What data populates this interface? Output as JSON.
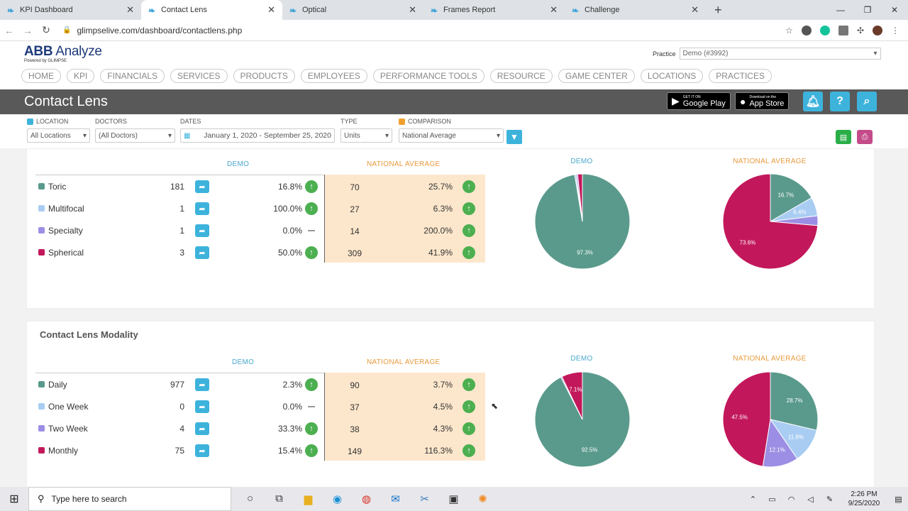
{
  "browser": {
    "tabs": [
      {
        "label": "KPI Dashboard",
        "active": false
      },
      {
        "label": "Contact Lens",
        "active": true
      },
      {
        "label": "Optical",
        "active": false
      },
      {
        "label": "Frames Report",
        "active": false
      },
      {
        "label": "Challenge",
        "active": false
      }
    ],
    "url": "glimpselive.com/dashboard/contactlens.php"
  },
  "header": {
    "logo_main_1": "ABB",
    "logo_main_2": " Analyze",
    "logo_sub": "Powered by GLIMPSE",
    "practice_label": "Practice",
    "practice_value": "Demo (#3992)",
    "menu": [
      "HOME",
      "KPI",
      "FINANCIALS",
      "SERVICES",
      "PRODUCTS",
      "EMPLOYEES",
      "PERFORMANCE TOOLS",
      "RESOURCE",
      "GAME CENTER",
      "LOCATIONS",
      "PRACTICES"
    ]
  },
  "titlebar": {
    "title": "Contact Lens",
    "google_small": "GET IT ON",
    "google_big": "Google Play",
    "apple_small": "Download on the",
    "apple_big": "App Store"
  },
  "filters": {
    "location_label": "LOCATION",
    "location_value": "All Locations",
    "doctors_label": "DOCTORS",
    "doctors_value": "(All Doctors)",
    "dates_label": "DATES",
    "dates_value": "January 1, 2020 - September 25, 2020",
    "type_label": "TYPE",
    "type_value": "Units",
    "comparison_label": "COMPARISON",
    "comparison_value": "National Average"
  },
  "colors": {
    "teal": "#5a9a8c",
    "lightblue": "#a9cdf2",
    "purple": "#9c8ee4",
    "magenta": "#c2185b",
    "accent": "#3db3dc"
  },
  "section1": {
    "demo_header": "DEMO",
    "nat_header": "NATIONAL AVERAGE",
    "pie_demo_label": "DEMO",
    "pie_nat_label": "NATIONAL AVERAGE",
    "rows": [
      {
        "label": "Toric",
        "count": "181",
        "pct": "16.8%",
        "trend": "up",
        "nat_count": "70",
        "nat_pct": "25.7%"
      },
      {
        "label": "Multifocal",
        "count": "1",
        "pct": "100.0%",
        "trend": "up",
        "nat_count": "27",
        "nat_pct": "6.3%"
      },
      {
        "label": "Specialty",
        "count": "1",
        "pct": "0.0%",
        "trend": "flat",
        "nat_count": "14",
        "nat_pct": "200.0%"
      },
      {
        "label": "Spherical",
        "count": "3",
        "pct": "50.0%",
        "trend": "up",
        "nat_count": "309",
        "nat_pct": "41.9%"
      }
    ],
    "pie_demo": [
      {
        "value": 97.3,
        "label": "97.3%"
      },
      {
        "value": 0.5,
        "label": ""
      },
      {
        "value": 0.5,
        "label": ""
      },
      {
        "value": 1.6,
        "label": ""
      }
    ],
    "pie_nat": [
      {
        "value": 16.7,
        "label": "16.7%"
      },
      {
        "value": 6.4,
        "label": "6.4%"
      },
      {
        "value": 3.3,
        "label": ""
      },
      {
        "value": 73.6,
        "label": "73.6%"
      }
    ]
  },
  "section2": {
    "title": "Contact Lens Modality",
    "demo_header": "DEMO",
    "nat_header": "NATIONAL AVERAGE",
    "pie_demo_label": "DEMO",
    "pie_nat_label": "NATIONAL AVERAGE",
    "rows": [
      {
        "label": "Daily",
        "count": "977",
        "pct": "2.3%",
        "trend": "up",
        "nat_count": "90",
        "nat_pct": "3.7%"
      },
      {
        "label": "One Week",
        "count": "0",
        "pct": "0.0%",
        "trend": "flat",
        "nat_count": "37",
        "nat_pct": "4.5%"
      },
      {
        "label": "Two Week",
        "count": "4",
        "pct": "33.3%",
        "trend": "up",
        "nat_count": "38",
        "nat_pct": "4.3%"
      },
      {
        "label": "Monthly",
        "count": "75",
        "pct": "15.4%",
        "trend": "up",
        "nat_count": "149",
        "nat_pct": "116.3%"
      }
    ],
    "pie_demo": [
      {
        "value": 92.5,
        "label": "92.5%"
      },
      {
        "value": 0,
        "label": ""
      },
      {
        "value": 0.4,
        "label": ""
      },
      {
        "value": 7.1,
        "label": "7.1%"
      }
    ],
    "pie_nat": [
      {
        "value": 28.7,
        "label": "28.7%"
      },
      {
        "value": 11.8,
        "label": "11.8%"
      },
      {
        "value": 12.1,
        "label": "12.1%"
      },
      {
        "value": 47.5,
        "label": "47.5%"
      }
    ]
  },
  "taskbar": {
    "search_placeholder": "Type here to search",
    "time": "2:26 PM",
    "date": "9/25/2020"
  }
}
